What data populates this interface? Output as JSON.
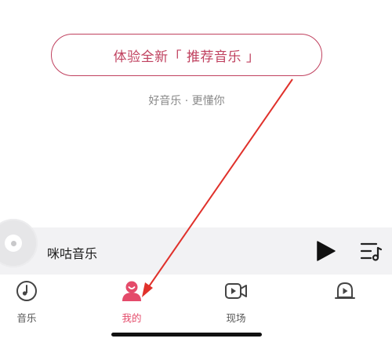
{
  "promo": {
    "button_label": "体验全新「 推荐音乐 」",
    "tagline": "好音乐 · 更懂你"
  },
  "player": {
    "track_title": "咪咕音乐",
    "play_icon": "play-icon",
    "playlist_icon": "playlist-icon"
  },
  "tabs": [
    {
      "label": "音乐",
      "icon": "music-disc-icon",
      "active": false
    },
    {
      "label": "我的",
      "icon": "profile-icon",
      "active": true
    },
    {
      "label": "现场",
      "icon": "live-video-icon",
      "active": false
    },
    {
      "label": "",
      "icon": "ringtone-bell-icon",
      "active": false
    }
  ],
  "colors": {
    "accent": "#e44b6a",
    "cta_border": "#c0415f",
    "annotation_arrow": "#e0312b"
  }
}
